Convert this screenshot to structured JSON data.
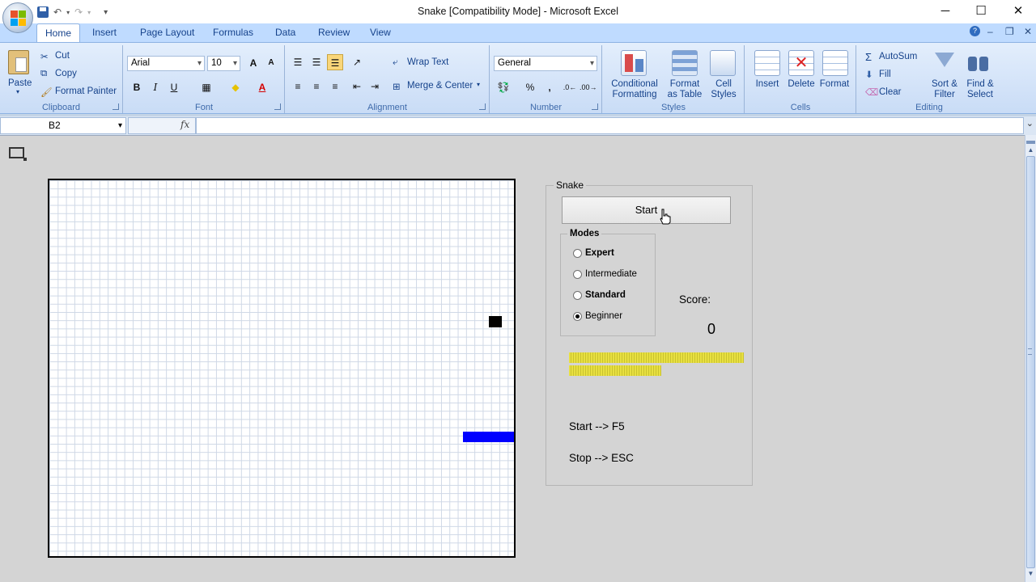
{
  "window": {
    "title": "Snake  [Compatibility Mode] - Microsoft Excel",
    "minimize": "─",
    "maximize": "☐",
    "close": "✕"
  },
  "qat": {
    "undo": "↶",
    "redo": "↷",
    "customize": "▾"
  },
  "tabs": [
    "Home",
    "Insert",
    "Page Layout",
    "Formulas",
    "Data",
    "Review",
    "View"
  ],
  "ribbon": {
    "clipboard": {
      "label": "Clipboard",
      "paste": "Paste",
      "cut": "Cut",
      "copy": "Copy",
      "format_painter": "Format Painter"
    },
    "font": {
      "label": "Font",
      "name": "Arial",
      "size": "10",
      "bold": "B",
      "italic": "I",
      "underline": "U",
      "grow": "A",
      "shrink": "A"
    },
    "alignment": {
      "label": "Alignment",
      "wrap_text": "Wrap Text",
      "merge_center": "Merge & Center"
    },
    "number": {
      "label": "Number",
      "format": "General",
      "percent": "%",
      "comma": ","
    },
    "styles": {
      "label": "Styles",
      "conditional_1": "Conditional",
      "conditional_2": "Formatting",
      "format_table_1": "Format",
      "format_table_2": "as Table",
      "cell_styles_1": "Cell",
      "cell_styles_2": "Styles"
    },
    "cells": {
      "label": "Cells",
      "insert": "Insert",
      "delete": "Delete",
      "format": "Format"
    },
    "editing": {
      "label": "Editing",
      "autosum": "AutoSum",
      "fill": "Fill",
      "clear": "Clear",
      "sort_1": "Sort &",
      "sort_2": "Filter",
      "find_1": "Find &",
      "find_2": "Select"
    }
  },
  "formula_bar": {
    "name_box": "B2",
    "fx": "fx",
    "value": ""
  },
  "game": {
    "panel_title": "Snake",
    "start_button": "Start",
    "modes_title": "Modes",
    "modes": [
      {
        "label": "Expert",
        "selected": false
      },
      {
        "label": "Intermediate",
        "selected": false
      },
      {
        "label": "Standard",
        "selected": false
      },
      {
        "label": "Beginner",
        "selected": true
      }
    ],
    "score_label": "Score:",
    "score": "0",
    "hint_start": "Start --> F5",
    "hint_stop": "Stop --> ESC",
    "colors": {
      "snake": "#0000ff",
      "food": "#000000",
      "speed_bar": "#e8e040"
    }
  },
  "icons": [
    "office-button-icon",
    "save-icon",
    "undo-icon",
    "redo-icon",
    "help-icon",
    "paste-icon",
    "cut-icon",
    "copy-icon",
    "format-painter-icon",
    "wrap-text-icon",
    "merge-center-icon",
    "autosum-icon",
    "fill-icon",
    "clear-icon",
    "sort-filter-icon",
    "find-select-icon",
    "cursor-hand-icon"
  ]
}
